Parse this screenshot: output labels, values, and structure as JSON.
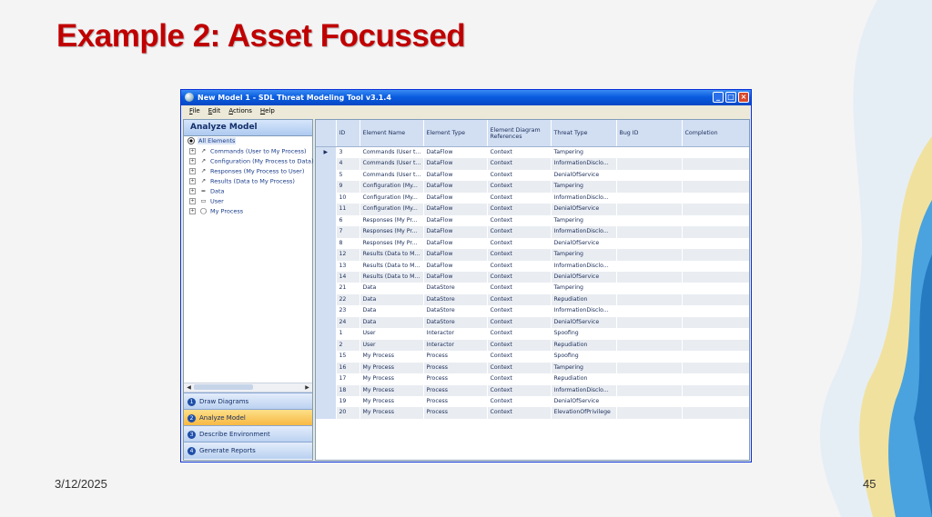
{
  "slide": {
    "title": "Example 2: Asset Focussed",
    "date": "3/12/2025",
    "page_number": "45"
  },
  "window": {
    "title": "New Model 1 - SDL Threat Modeling Tool v3.1.4",
    "minimize_icon": "minimize-icon",
    "maximize_icon": "maximize-icon",
    "close_icon": "close-icon"
  },
  "menu": [
    {
      "label": "File",
      "u": "F",
      "rest": "ile"
    },
    {
      "label": "Edit",
      "u": "E",
      "rest": "dit"
    },
    {
      "label": "Actions",
      "u": "A",
      "rest": "ctions"
    },
    {
      "label": "Help",
      "u": "H",
      "rest": "elp"
    }
  ],
  "left_panel": {
    "header": "Analyze Model",
    "tree_root": "All Elements",
    "tree_items": [
      {
        "label": "Commands (User to My Process)",
        "icon": "dataflow-arrow-icon"
      },
      {
        "label": "Configuration (My Process to Data)",
        "icon": "dataflow-arrow-icon"
      },
      {
        "label": "Responses (My Process to User)",
        "icon": "dataflow-arrow-icon"
      },
      {
        "label": "Results (Data to My Process)",
        "icon": "dataflow-arrow-icon"
      },
      {
        "label": "Data",
        "icon": "datastore-icon"
      },
      {
        "label": "User",
        "icon": "interactor-icon"
      },
      {
        "label": "My Process",
        "icon": "process-icon"
      }
    ],
    "nav": [
      {
        "num": "1",
        "label": "Draw Diagrams",
        "active": false
      },
      {
        "num": "2",
        "label": "Analyze Model",
        "active": true
      },
      {
        "num": "3",
        "label": "Describe Environment",
        "active": false
      },
      {
        "num": "4",
        "label": "Generate Reports",
        "active": false
      }
    ]
  },
  "grid": {
    "columns": [
      "ID",
      "Element Name",
      "Element Type",
      "Element Diagram References",
      "Threat Type",
      "Bug ID",
      "Completion"
    ],
    "rows": [
      [
        "3",
        "Commands (User t...",
        "DataFlow",
        "Context",
        "Tampering",
        "",
        ""
      ],
      [
        "4",
        "Commands (User t...",
        "DataFlow",
        "Context",
        "InformationDisclo...",
        "",
        ""
      ],
      [
        "5",
        "Commands (User t...",
        "DataFlow",
        "Context",
        "DenialOfService",
        "",
        ""
      ],
      [
        "9",
        "Configuration (My...",
        "DataFlow",
        "Context",
        "Tampering",
        "",
        ""
      ],
      [
        "10",
        "Configuration (My...",
        "DataFlow",
        "Context",
        "InformationDisclo...",
        "",
        ""
      ],
      [
        "11",
        "Configuration (My...",
        "DataFlow",
        "Context",
        "DenialOfService",
        "",
        ""
      ],
      [
        "6",
        "Responses (My Pr...",
        "DataFlow",
        "Context",
        "Tampering",
        "",
        ""
      ],
      [
        "7",
        "Responses (My Pr...",
        "DataFlow",
        "Context",
        "InformationDisclo...",
        "",
        ""
      ],
      [
        "8",
        "Responses (My Pr...",
        "DataFlow",
        "Context",
        "DenialOfService",
        "",
        ""
      ],
      [
        "12",
        "Results (Data to M...",
        "DataFlow",
        "Context",
        "Tampering",
        "",
        ""
      ],
      [
        "13",
        "Results (Data to M...",
        "DataFlow",
        "Context",
        "InformationDisclo...",
        "",
        ""
      ],
      [
        "14",
        "Results (Data to M...",
        "DataFlow",
        "Context",
        "DenialOfService",
        "",
        ""
      ],
      [
        "21",
        "Data",
        "DataStore",
        "Context",
        "Tampering",
        "",
        ""
      ],
      [
        "22",
        "Data",
        "DataStore",
        "Context",
        "Repudiation",
        "",
        ""
      ],
      [
        "23",
        "Data",
        "DataStore",
        "Context",
        "InformationDisclo...",
        "",
        ""
      ],
      [
        "24",
        "Data",
        "DataStore",
        "Context",
        "DenialOfService",
        "",
        ""
      ],
      [
        "1",
        "User",
        "Interactor",
        "Context",
        "Spoofing",
        "",
        ""
      ],
      [
        "2",
        "User",
        "Interactor",
        "Context",
        "Repudiation",
        "",
        ""
      ],
      [
        "15",
        "My Process",
        "Process",
        "Context",
        "Spoofing",
        "",
        ""
      ],
      [
        "16",
        "My Process",
        "Process",
        "Context",
        "Tampering",
        "",
        ""
      ],
      [
        "17",
        "My Process",
        "Process",
        "Context",
        "Repudiation",
        "",
        ""
      ],
      [
        "18",
        "My Process",
        "Process",
        "Context",
        "InformationDisclo...",
        "",
        ""
      ],
      [
        "19",
        "My Process",
        "Process",
        "Context",
        "DenialOfService",
        "",
        ""
      ],
      [
        "20",
        "My Process",
        "Process",
        "Context",
        "ElevationOfPrivilege",
        "",
        ""
      ]
    ],
    "current_row_marker": "▶"
  },
  "colors": {
    "title": "#c00000",
    "titlebar": "#0a5ce0",
    "nav_active": "#f7b63e"
  }
}
